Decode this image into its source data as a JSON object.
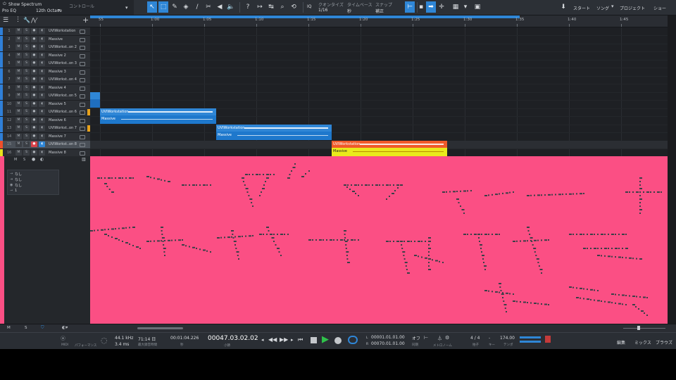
{
  "topbar": {
    "show_spectrum": "Show Spectrum",
    "plugin": "Pro EQ",
    "preset": "12th Octave",
    "control": "コントロール",
    "quantize_label": "クオンタイズ",
    "quantize_value": "1/16",
    "timebase_label": "タイムベース",
    "timebase_value": "秒",
    "snap_label": "スナップ",
    "snap_value": "補正",
    "start": "スタート",
    "song": "ソング",
    "project": "プロジェクト",
    "show": "ショー",
    "iq": "IQ"
  },
  "tracks": [
    {
      "num": "1",
      "name": "UVIWorkstation",
      "color": "#2f7fd8"
    },
    {
      "num": "2",
      "name": "Massive",
      "color": "#2f7fd8"
    },
    {
      "num": "3",
      "name": "UVIWorkst..on 2",
      "color": "#2f7fd8"
    },
    {
      "num": "4",
      "name": "Massive 2",
      "color": "#2f7fd8"
    },
    {
      "num": "5",
      "name": "UVIWorkst..on 3",
      "color": "#2f7fd8"
    },
    {
      "num": "6",
      "name": "Massive 3",
      "color": "#2f7fd8"
    },
    {
      "num": "7",
      "name": "UVIWorkst..on 4",
      "color": "#2f7fd8"
    },
    {
      "num": "8",
      "name": "Massive 4",
      "color": "#2f7fd8"
    },
    {
      "num": "9",
      "name": "UVIWorkst..on 5",
      "color": "#2f7fd8"
    },
    {
      "num": "10",
      "name": "Massive 5",
      "color": "#2f7fd8"
    },
    {
      "num": "11",
      "name": "UVIWorkst..on 6",
      "color": "#2f7fd8"
    },
    {
      "num": "12",
      "name": "Massive 6",
      "color": "#2f7fd8"
    },
    {
      "num": "13",
      "name": "UVIWorkst..on 7",
      "color": "#2f7fd8"
    },
    {
      "num": "14",
      "name": "Massive 7",
      "color": "#2f7fd8"
    },
    {
      "num": "15",
      "name": "UVIWorkst..on 8",
      "color": "#f04f2a"
    },
    {
      "num": "16",
      "name": "Massive 8",
      "color": "#e8e21c"
    }
  ],
  "ruler": [
    "55",
    "1:00",
    "1:05",
    "1:10",
    "1:15",
    "1:20",
    "1:25",
    "1:30",
    "1:35",
    "1:40",
    "1:45"
  ],
  "clips": [
    {
      "label": "UVIWorkstation",
      "sub": "Massive",
      "color": "#2f86d6"
    },
    {
      "label": "UVIWorkstation",
      "sub": "Massive",
      "color": "#2f86d6"
    },
    {
      "label": "UVIWorkstation",
      "sub": "Massive",
      "color": "#f05a2a",
      "sub_color": "#eaea1c"
    }
  ],
  "inspector": {
    "out1": "なし",
    "out2": "なし",
    "out3": "なし",
    "val": "1"
  },
  "bottom": {
    "m": "M",
    "s": "S"
  },
  "transport": {
    "midi": "MIDI",
    "performance": "パフォーマンス",
    "sample_rate": "44.1 kHz",
    "latency": "3.4 ms",
    "record_time": "71:14 日",
    "record_label": "最大録音時間",
    "timecode": "00:01:04.226",
    "timecode_unit": "秒",
    "position": "00047.03.02.02",
    "position_unit": "小節",
    "loop_l": "00001.01.01.00",
    "loop_r": "00070.01.01.00",
    "sync": "オフ",
    "sync_label": "同期",
    "metronome": "メトロノーム",
    "time_sig": "4 / 4",
    "time_sig_label": "拍子",
    "key_label": "キー",
    "key": "-",
    "tempo": "174.00",
    "tempo_label": "テンポ",
    "edit": "編集",
    "mix": "ミックス",
    "browse": "ブラウズ"
  },
  "colors": {
    "editor_bg": "#fb4f84",
    "accent": "#2f86d6"
  }
}
